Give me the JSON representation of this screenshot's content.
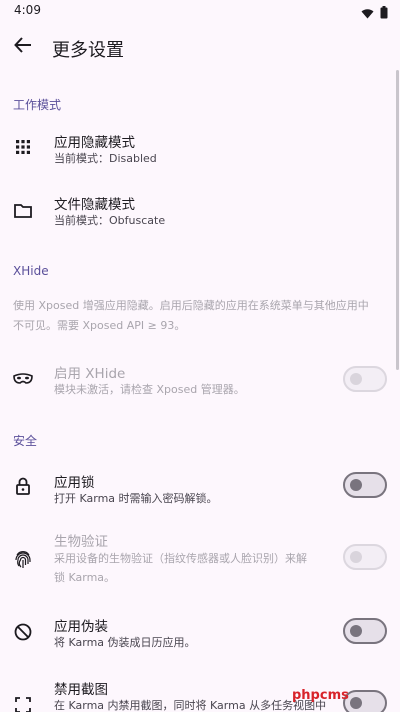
{
  "status_bar": {
    "time": "4:09"
  },
  "appbar": {
    "title": "更多设置"
  },
  "sections": {
    "work_mode": {
      "header": "工作模式",
      "items": [
        {
          "title": "应用隐藏模式",
          "subtitle": "当前模式：Disabled",
          "icon": "grid-icon"
        },
        {
          "title": "文件隐藏模式",
          "subtitle": "当前模式：Obfuscate",
          "icon": "folder-icon"
        }
      ]
    },
    "xhide": {
      "header": "XHide",
      "info_line1": "使用 Xposed 增强应用隐藏。启用后隐藏的应用在系统菜单与其他应用中",
      "info_line2": "不可见。需要 Xposed API ≥ 93。",
      "item": {
        "title": "启用 XHide",
        "subtitle": "模块未激活，请检查 Xposed 管理器。",
        "icon": "mask-icon",
        "checked": false,
        "enabled": false
      }
    },
    "security": {
      "header": "安全",
      "items": [
        {
          "title": "应用锁",
          "subtitle": "打开 Karma 时需输入密码解锁。",
          "icon": "lock-icon",
          "checked": false,
          "enabled": true
        },
        {
          "title": "生物验证",
          "subtitle_line1": "采用设备的生物验证（指纹传感器或人脸识别）来解",
          "subtitle_line2": "锁 Karma。",
          "icon": "fingerprint-icon",
          "checked": false,
          "enabled": false
        },
        {
          "title": "应用伪装",
          "subtitle": "将 Karma 伪装成日历应用。",
          "icon": "disguise-icon",
          "checked": false,
          "enabled": true
        },
        {
          "title": "禁用截图",
          "subtitle": "在 Karma 内禁用截图，同时将 Karma 从多任务视图中",
          "icon": "screenshot-icon",
          "checked": false,
          "enabled": true
        }
      ]
    }
  },
  "watermark": "phpcms"
}
